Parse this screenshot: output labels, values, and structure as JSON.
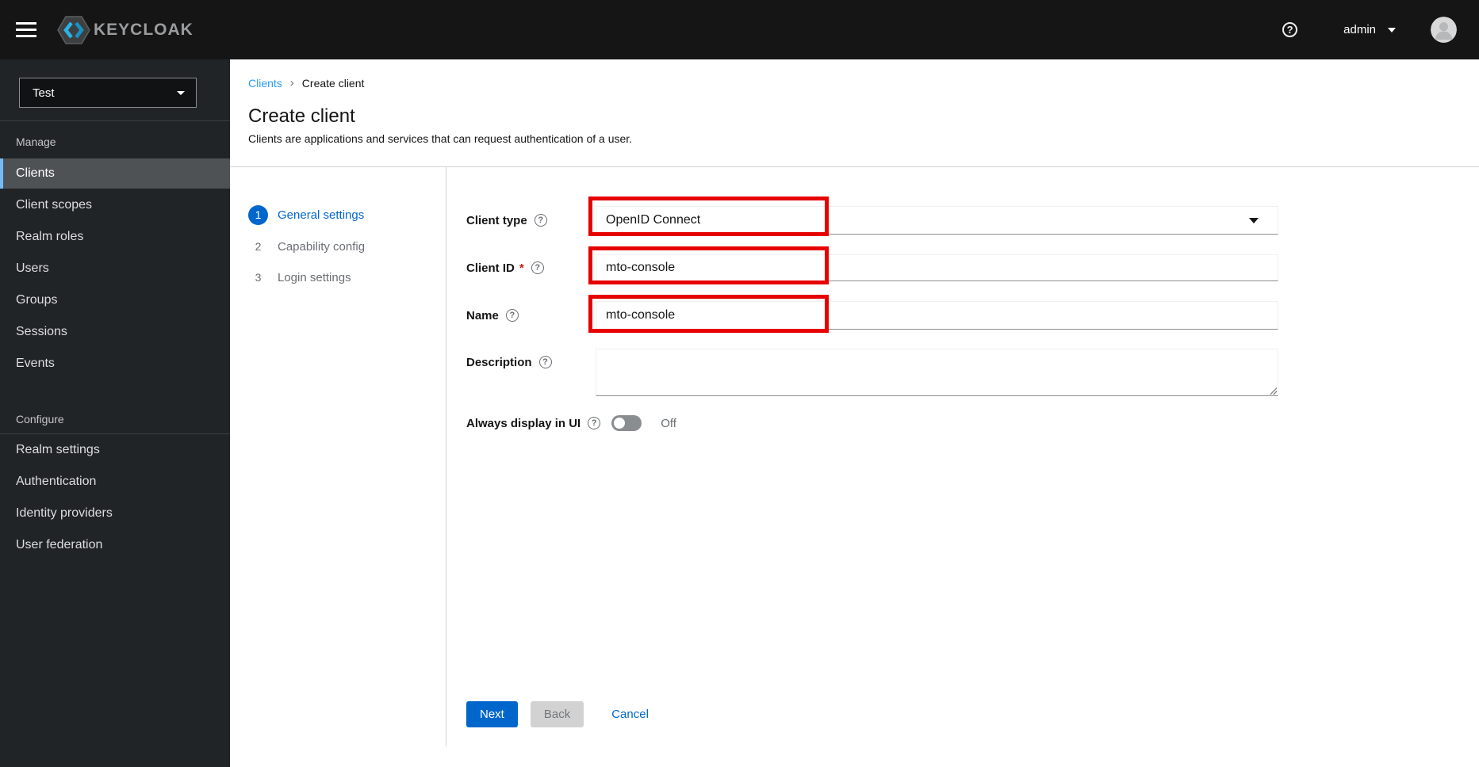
{
  "masthead": {
    "brand": "KEYCLOAK",
    "username": "admin"
  },
  "sidebar": {
    "realm": "Test",
    "sections": [
      {
        "label": "Manage",
        "items": [
          "Clients",
          "Client scopes",
          "Realm roles",
          "Users",
          "Groups",
          "Sessions",
          "Events"
        ],
        "selected": "Clients"
      },
      {
        "label": "Configure",
        "items": [
          "Realm settings",
          "Authentication",
          "Identity providers",
          "User federation"
        ]
      }
    ]
  },
  "breadcrumb": {
    "parent": "Clients",
    "separator": "›",
    "current": "Create client"
  },
  "page": {
    "title": "Create client",
    "subtitle": "Clients are applications and services that can request authentication of a user."
  },
  "wizard": {
    "steps": [
      {
        "num": "1",
        "label": "General settings",
        "active": true
      },
      {
        "num": "2",
        "label": "Capability config",
        "active": false
      },
      {
        "num": "3",
        "label": "Login settings",
        "active": false
      }
    ]
  },
  "form": {
    "client_type": {
      "label": "Client type",
      "value": "OpenID Connect"
    },
    "client_id": {
      "label": "Client ID",
      "required": "*",
      "value": "mto-console"
    },
    "name": {
      "label": "Name",
      "value": "mto-console"
    },
    "description": {
      "label": "Description",
      "value": ""
    },
    "always_display": {
      "label": "Always display in UI",
      "state": "Off"
    },
    "help_glyph": "?"
  },
  "footer": {
    "next": "Next",
    "back": "Back",
    "cancel": "Cancel"
  },
  "colors": {
    "primary_blue": "#0066cc",
    "breadcrumb_link": "#2b9af3",
    "nav_selected_accent": "#73bcf7",
    "annotation_red": "#e60000",
    "masthead_bg": "#151515",
    "sidebar_bg": "#212427"
  }
}
